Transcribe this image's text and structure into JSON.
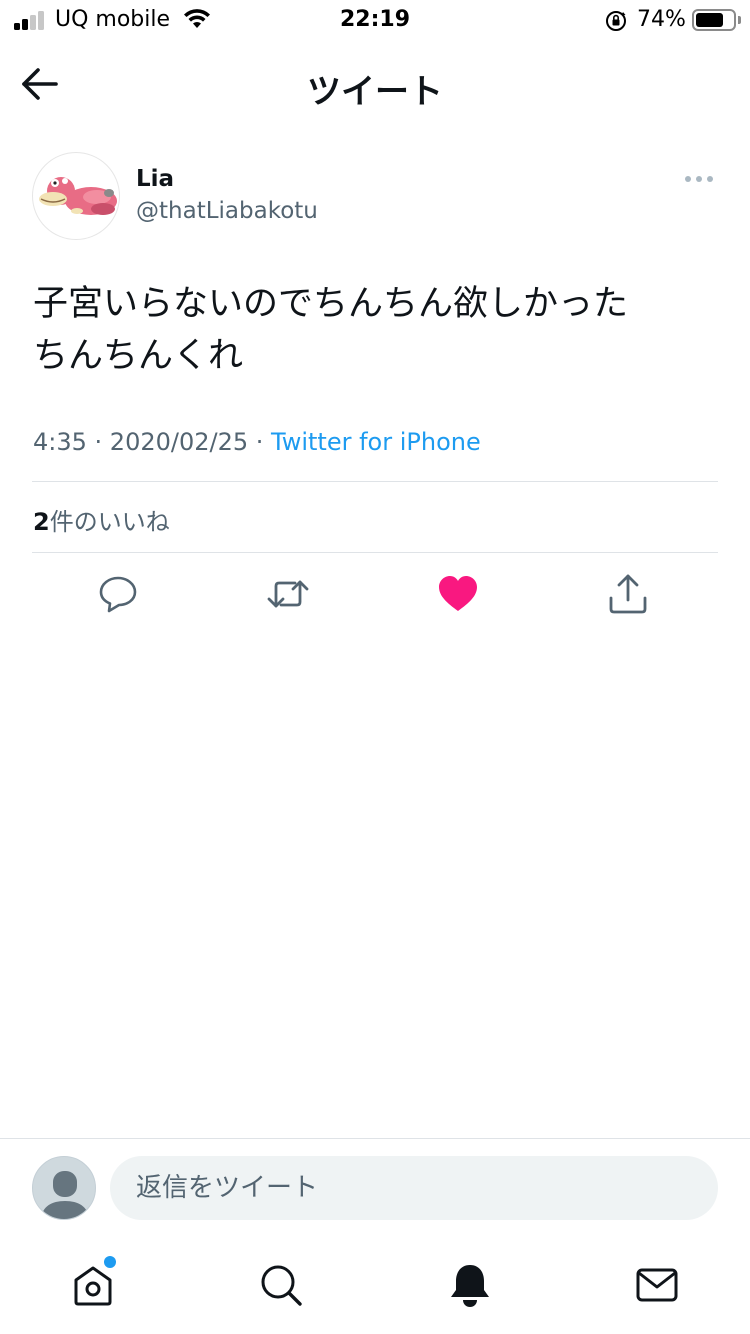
{
  "status_bar": {
    "carrier": "UQ mobile",
    "time": "22:19",
    "battery_percent": "74%",
    "battery_level": 0.74,
    "signal_bars": 2,
    "icons": [
      "signal-icon",
      "wifi-icon",
      "rotation-lock-icon",
      "battery-icon"
    ]
  },
  "header": {
    "title": "ツイート",
    "back_icon": "arrow-left-icon"
  },
  "tweet": {
    "author": {
      "display_name": "Lia",
      "handle": "@thatLiabakotu"
    },
    "text": "子宮いらないのでちんちん欲しかった\nちんちんくれ",
    "time": "4:35",
    "date": "2020/02/25",
    "separator": " · ",
    "source": "Twitter for iPhone",
    "likes": {
      "count": "2",
      "label": "件のいいね"
    },
    "actions": [
      "reply-icon",
      "retweet-icon",
      "like-icon",
      "share-icon"
    ],
    "liked": true
  },
  "reply_bar": {
    "placeholder": "返信をツイート"
  },
  "tab_bar": {
    "tabs": [
      "home-icon",
      "search-icon",
      "notifications-icon",
      "messages-icon"
    ],
    "home_has_badge": true
  },
  "colors": {
    "accent": "#1d9bf0",
    "like": "#f91880",
    "text_primary": "#0f1419",
    "text_secondary": "#536471",
    "divider": "#dfe3e7"
  }
}
